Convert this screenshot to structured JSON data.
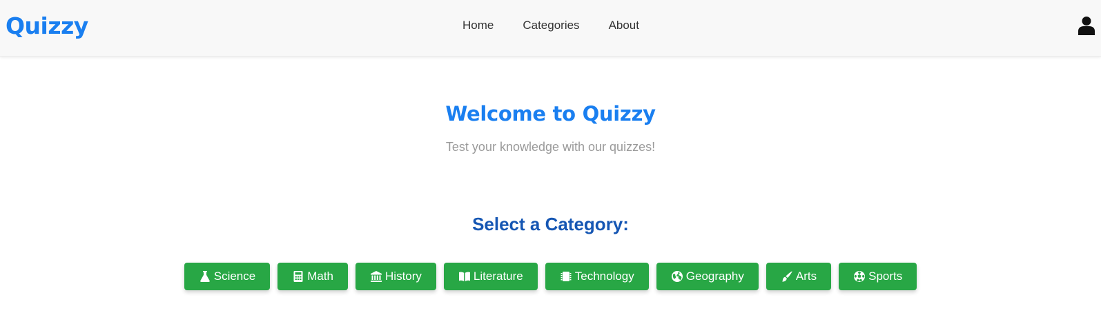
{
  "header": {
    "brand": "Quizzy",
    "nav": [
      "Home",
      "Categories",
      "About"
    ],
    "user_icon": "user-icon"
  },
  "hero": {
    "title": "Welcome to Quizzy",
    "subtitle": "Test your knowledge with our quizzes!"
  },
  "categories": {
    "heading": "Select a Category:",
    "items": [
      {
        "label": "Science",
        "icon": "flask-icon"
      },
      {
        "label": "Math",
        "icon": "calculator-icon"
      },
      {
        "label": "History",
        "icon": "landmark-icon"
      },
      {
        "label": "Literature",
        "icon": "book-icon"
      },
      {
        "label": "Technology",
        "icon": "chip-icon"
      },
      {
        "label": "Geography",
        "icon": "globe-icon"
      },
      {
        "label": "Arts",
        "icon": "paintbrush-icon"
      },
      {
        "label": "Sports",
        "icon": "soccer-ball-icon"
      }
    ]
  },
  "colors": {
    "brand": "#1a7ff0",
    "heading": "#1556b3",
    "button": "#28a745",
    "navbar_bg": "#f8f8f8"
  }
}
